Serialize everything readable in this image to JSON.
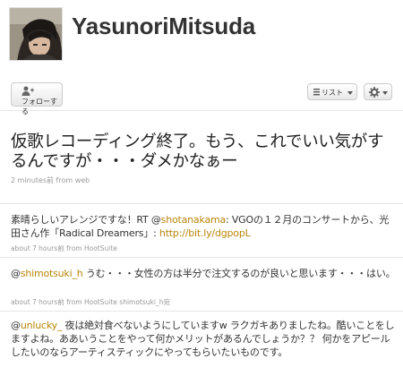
{
  "profile": {
    "screen_name": "YasunoriMitsuda"
  },
  "actions": {
    "follow_label": "フォローする",
    "list_label": "リスト"
  },
  "featured": {
    "text": "仮歌レコーディング終了。もう、これでいい気がするんですが・・・ダメかなぁー",
    "meta": "2 minutes前  from web"
  },
  "tweets": [
    {
      "text_before": "素晴らしいアレンジですな！RT @",
      "mention": "shotanakama",
      "text_middle": ": VGOの１２月のコンサートから、光田さん作「Radical Dreamers」: ",
      "link": "http://bit.ly/dgpopL",
      "meta": "about 7 hours前  from HootSuite"
    },
    {
      "text_before": "@",
      "mention": "shimotsuki_h",
      "text_middle": " うむ・・・女性の方は半分で注文するのが良いと思います・・・はい。",
      "meta": "about 7 hours前  from HootSuite  shimotsuki_h宛"
    },
    {
      "text_before": "@",
      "mention": "unlucky_",
      "text_middle": " 夜は絶対食べないようにしていますw ラクガキありましたね。酷いことをしますよね。ああいうことをやって何かメリットがあるんでしょうか？？ 何かをアピールしたいのならアーティスティックにやってもらいたいものです。"
    }
  ]
}
